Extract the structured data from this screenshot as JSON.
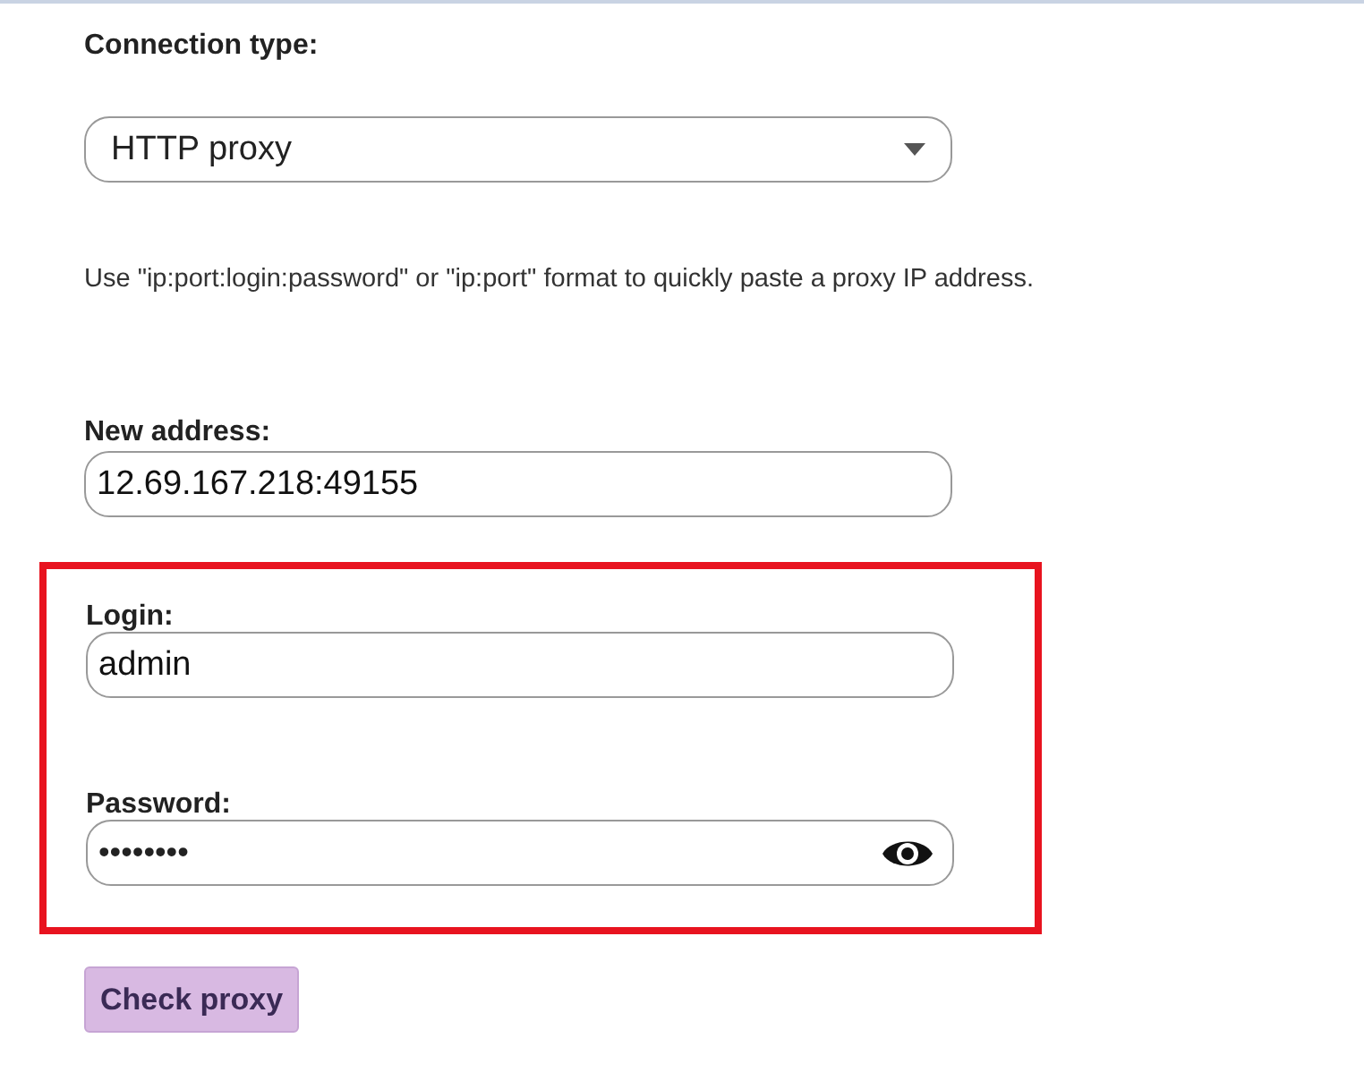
{
  "connection_type": {
    "label": "Connection type:",
    "value": "HTTP proxy"
  },
  "hint": "Use \"ip:port:login:password\" or \"ip:port\" format to quickly paste a proxy IP address.",
  "address": {
    "label": "New address:",
    "value": "12.69.167.218:49155"
  },
  "credentials": {
    "highlighted": true,
    "login": {
      "label": "Login:",
      "value": "admin"
    },
    "password": {
      "label": "Password:",
      "value": "••••••••"
    }
  },
  "check_button": "Check proxy"
}
